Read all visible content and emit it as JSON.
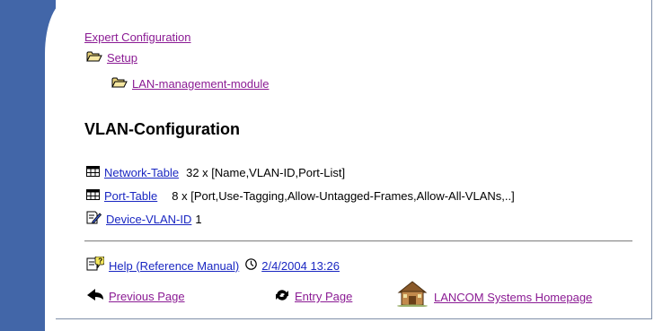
{
  "breadcrumb": {
    "root": "Expert Configuration",
    "level1": "Setup",
    "level2": "LAN-management-module"
  },
  "page_title": "VLAN-Configuration",
  "entries": [
    {
      "link": "Network-Table",
      "value": "32 x [Name,VLAN-ID,Port-List]",
      "icon": "table-icon"
    },
    {
      "link": "Port-Table",
      "value": "8 x [Port,Use-Tagging,Allow-Untagged-Frames,Allow-All-VLANs,..]",
      "icon": "table-icon"
    },
    {
      "link": "Device-VLAN-ID",
      "value": "1",
      "icon": "edit-value-icon"
    }
  ],
  "footer": {
    "help_link": "Help (Reference Manual)",
    "timestamp": "2/4/2004 13:26",
    "previous_page": "Previous Page",
    "entry_page": "Entry Page",
    "homepage": "LANCOM Systems Homepage"
  },
  "colors": {
    "sidebar_blue": "#4266a8",
    "link_blue": "#1a27c2",
    "visited_purple": "#8b1b94"
  }
}
